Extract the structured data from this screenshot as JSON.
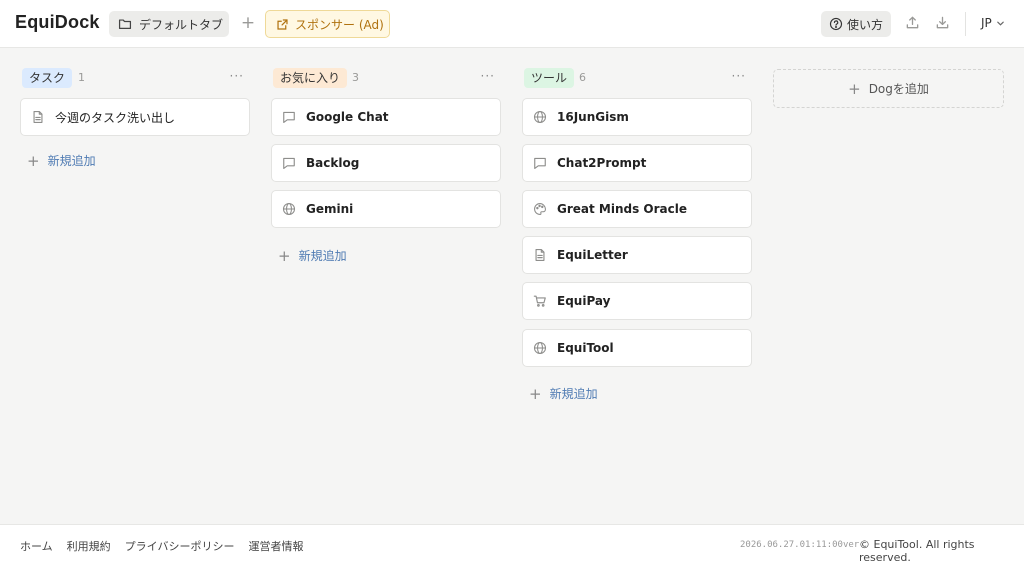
{
  "header": {
    "logo": "EquiDock",
    "tab_default": "デフォルトタブ",
    "add_tab_symbol": "+",
    "sponsor_label": "スポンサー (Ad)",
    "help_label": "使い方",
    "lang_label": "JP"
  },
  "columns": [
    {
      "title": "タスク",
      "count": "1",
      "badge_color": "#dbeafe",
      "menu": "···",
      "items": [
        {
          "label": "今週のタスク洗い出し",
          "icon": "document-icon"
        }
      ],
      "add_label": "新規追加"
    },
    {
      "title": "お気に入り",
      "count": "3",
      "badge_color": "#fde9d4",
      "menu": "···",
      "items": [
        {
          "label": "Google Chat",
          "icon": "chat-icon"
        },
        {
          "label": "Backlog",
          "icon": "chat-icon"
        },
        {
          "label": "Gemini",
          "icon": "globe-icon"
        }
      ],
      "add_label": "新規追加"
    },
    {
      "title": "ツール",
      "count": "6",
      "badge_color": "#dcf5e3",
      "menu": "···",
      "items": [
        {
          "label": "16JunGism",
          "icon": "globe-icon"
        },
        {
          "label": "Chat2Prompt",
          "icon": "chat-icon"
        },
        {
          "label": "Great Minds Oracle",
          "icon": "palette-icon"
        },
        {
          "label": "EquiLetter",
          "icon": "document-icon"
        },
        {
          "label": "EquiPay",
          "icon": "cart-icon"
        },
        {
          "label": "EquiTool",
          "icon": "globe-icon"
        }
      ],
      "add_label": "新規追加"
    }
  ],
  "add_dog_label": "Dogを追加",
  "footer": {
    "links": [
      "ホーム",
      "利用規約",
      "プライバシーポリシー",
      "運営者情報"
    ],
    "version": "2026.06.27.01:11:00ver",
    "copyright": "© EquiTool. All rights reserved."
  }
}
